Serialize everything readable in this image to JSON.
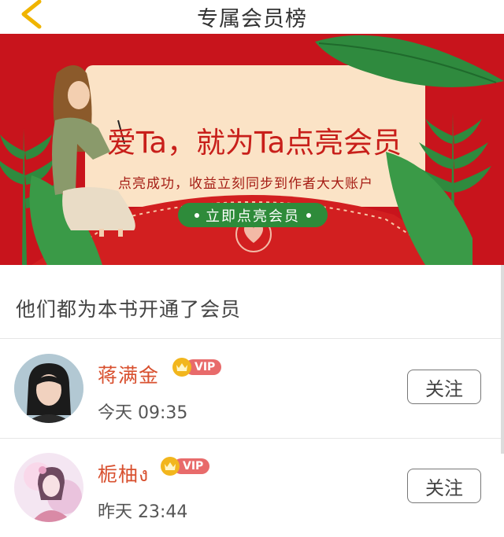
{
  "header": {
    "title": "专属会员榜",
    "back_icon": "chevron-left-icon"
  },
  "banner": {
    "headline": "爱Ta，就为Ta点亮会员",
    "subline": "点亮成功，收益立刻同步到作者大大账户",
    "button_label": "立即点亮会员",
    "colors": {
      "background": "#c8141c",
      "card": "#fbe3c6",
      "button": "#2e8b3a",
      "leaf": "#2f8a3e"
    }
  },
  "section": {
    "title": "他们都为本书开通了会员"
  },
  "members": [
    {
      "name": "蒋满金",
      "badge": "VIP",
      "time": "今天 09:35",
      "follow_label": "关注"
    },
    {
      "name": "栀柚ง",
      "badge": "VIP",
      "time": "昨天 23:44",
      "follow_label": "关注"
    }
  ]
}
